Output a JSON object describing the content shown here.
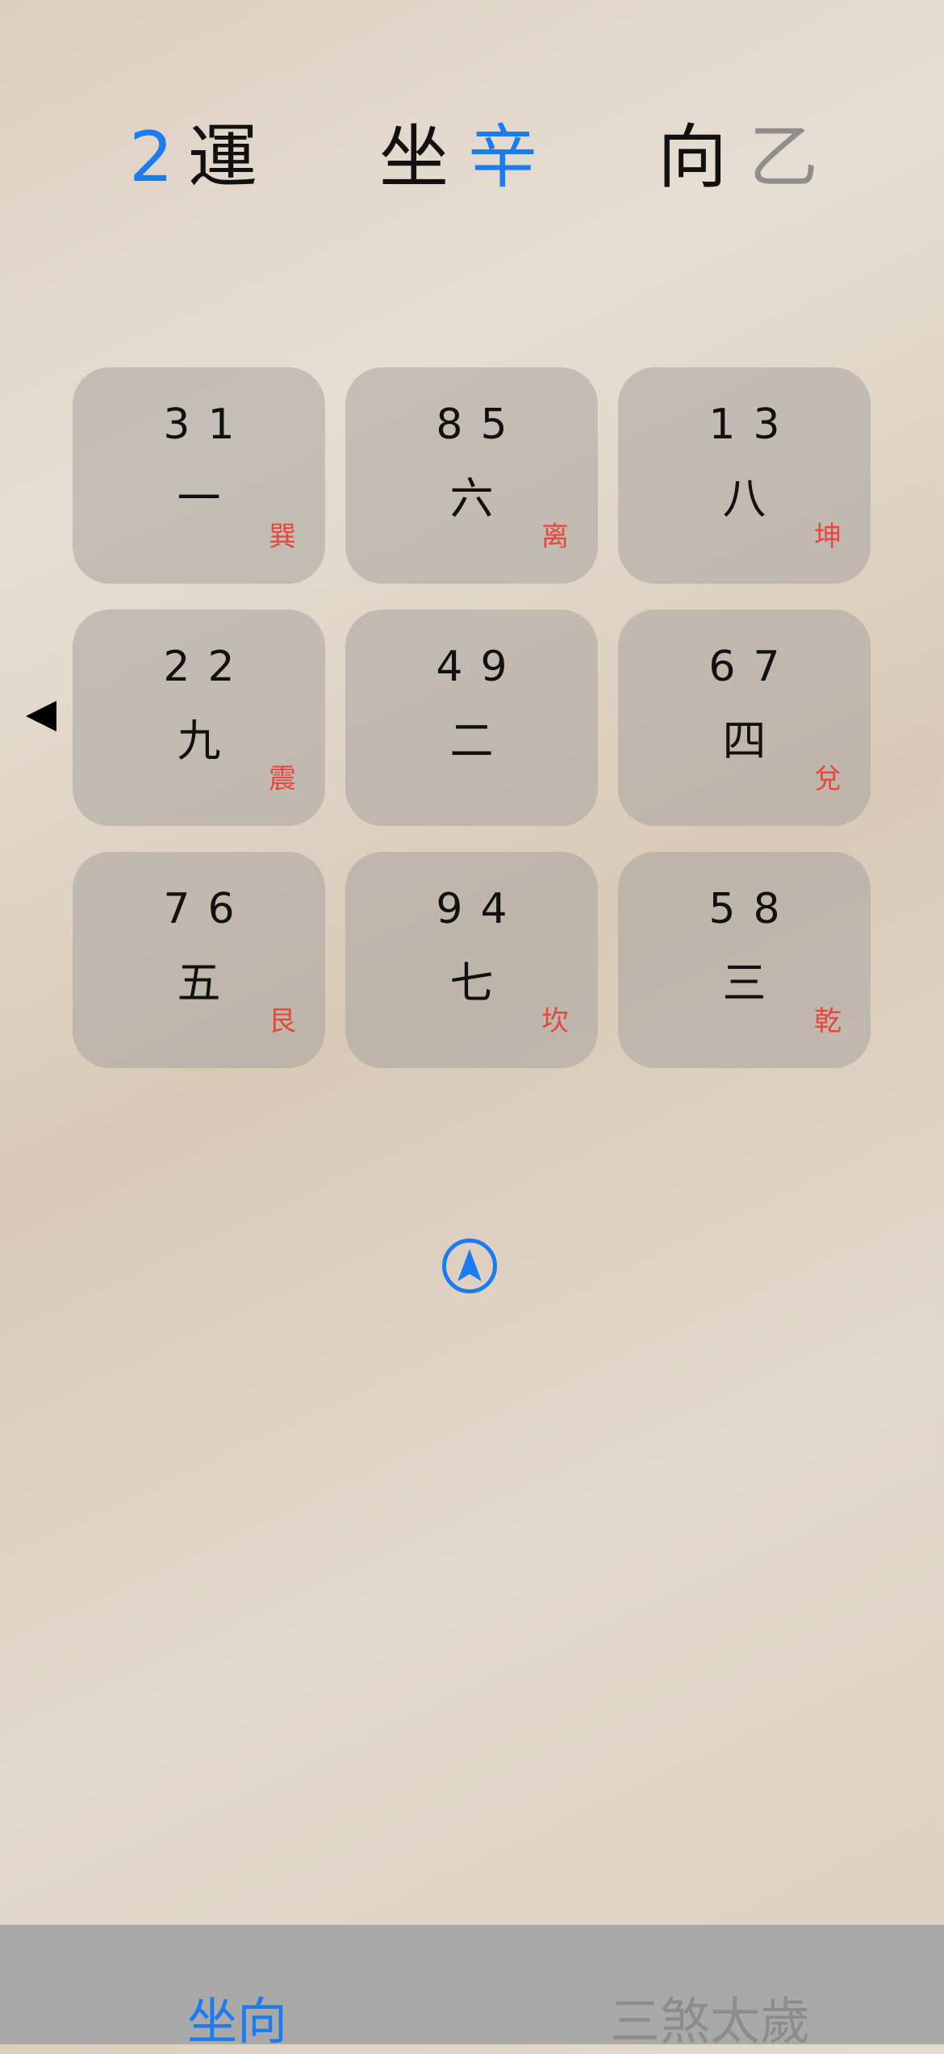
{
  "header": {
    "period_number": "2",
    "period_label": "運",
    "sitting_label": "坐",
    "sitting_value": "辛",
    "facing_label": "向",
    "facing_value": "乙"
  },
  "grid": [
    {
      "mountain": "3",
      "water": "1",
      "star": "一",
      "trigram": "巽"
    },
    {
      "mountain": "8",
      "water": "5",
      "star": "六",
      "trigram": "离"
    },
    {
      "mountain": "1",
      "water": "3",
      "star": "八",
      "trigram": "坤"
    },
    {
      "mountain": "2",
      "water": "2",
      "star": "九",
      "trigram": "震"
    },
    {
      "mountain": "4",
      "water": "9",
      "star": "二",
      "trigram": ""
    },
    {
      "mountain": "6",
      "water": "7",
      "star": "四",
      "trigram": "兌"
    },
    {
      "mountain": "7",
      "water": "6",
      "star": "五",
      "trigram": "艮"
    },
    {
      "mountain": "9",
      "water": "4",
      "star": "七",
      "trigram": "坎"
    },
    {
      "mountain": "5",
      "water": "8",
      "star": "三",
      "trigram": "乾"
    }
  ],
  "icons": {
    "side_arrow": "left-pointer-icon",
    "nav": "location-arrow-icon"
  },
  "tabs": [
    {
      "label": "坐向",
      "active": true
    },
    {
      "label": "三煞太歲",
      "active": false
    }
  ],
  "colors": {
    "accent": "#1a7cf0",
    "trigram": "#e8463c",
    "tabbar": "#a9a9a9"
  }
}
